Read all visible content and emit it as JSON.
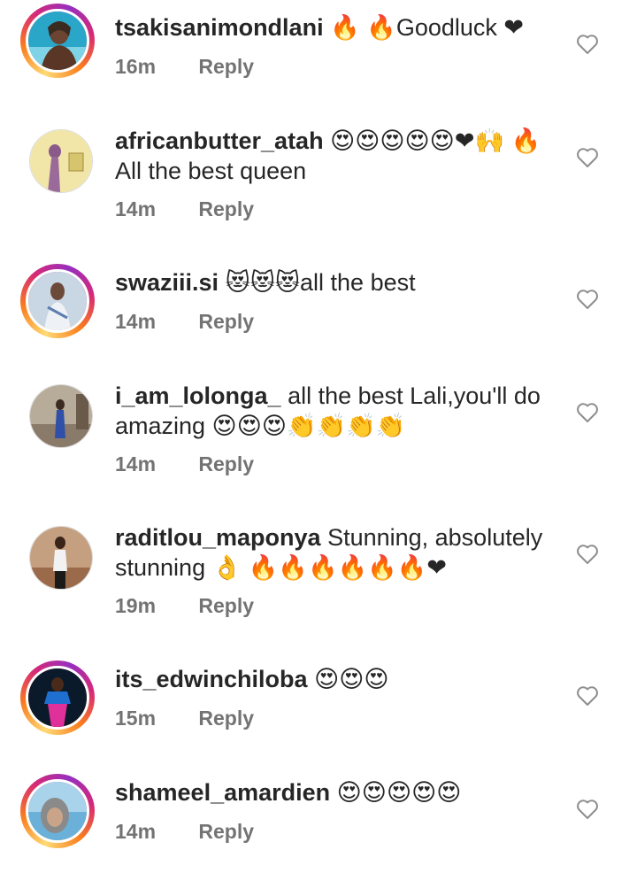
{
  "comments": [
    {
      "username": "tsakisanimondlani",
      "text": "🔥 🔥Goodluck ❤",
      "time": "16m",
      "reply_label": "Reply",
      "avatar_colors": [
        "#2aa6c9",
        "#7fd3e6",
        "#3b2a20"
      ]
    },
    {
      "username": "africanbutter_atah",
      "text": "😍😍😍😍😍❤🙌 🔥All the best queen",
      "time": "14m",
      "reply_label": "Reply",
      "avatar_colors": [
        "#f1e6a8",
        "#d6c56c",
        "#8a5a8a"
      ]
    },
    {
      "username": "swaziii.si",
      "text": "😻😻😻all the best",
      "time": "14m",
      "reply_label": "Reply",
      "avatar_colors": [
        "#c9d6e3",
        "#eef2f6",
        "#6b4a3a"
      ]
    },
    {
      "username": "i_am_lolonga_",
      "text": "all the best Lali,you'll do amazing 😍😍😍👏👏👏👏",
      "time": "14m",
      "reply_label": "Reply",
      "avatar_colors": [
        "#8a7a6a",
        "#b7ab9a",
        "#2f4fa8"
      ]
    },
    {
      "username": "raditlou_maponya",
      "text": "Stunning, absolutely stunning 👌 🔥🔥🔥🔥🔥🔥❤",
      "time": "19m",
      "reply_label": "Reply",
      "avatar_colors": [
        "#9a6a4a",
        "#c4a080",
        "#1a1a1a"
      ]
    },
    {
      "username": "its_edwinchiloba",
      "text": "😍😍😍",
      "time": "15m",
      "reply_label": "Reply",
      "avatar_colors": [
        "#0a1a2a",
        "#1e6fd0",
        "#e0309a"
      ]
    },
    {
      "username": "shameel_amardien",
      "text": "😍😍😍😍😍",
      "time": "14m",
      "reply_label": "Reply",
      "avatar_colors": [
        "#6ab0d8",
        "#a9d3ea",
        "#8a8a8a"
      ]
    }
  ],
  "colors": {
    "username": "#262626",
    "meta": "#737373",
    "heart_outline": "#8e8e8e"
  },
  "icons": {
    "like": "heart-outline-icon"
  }
}
